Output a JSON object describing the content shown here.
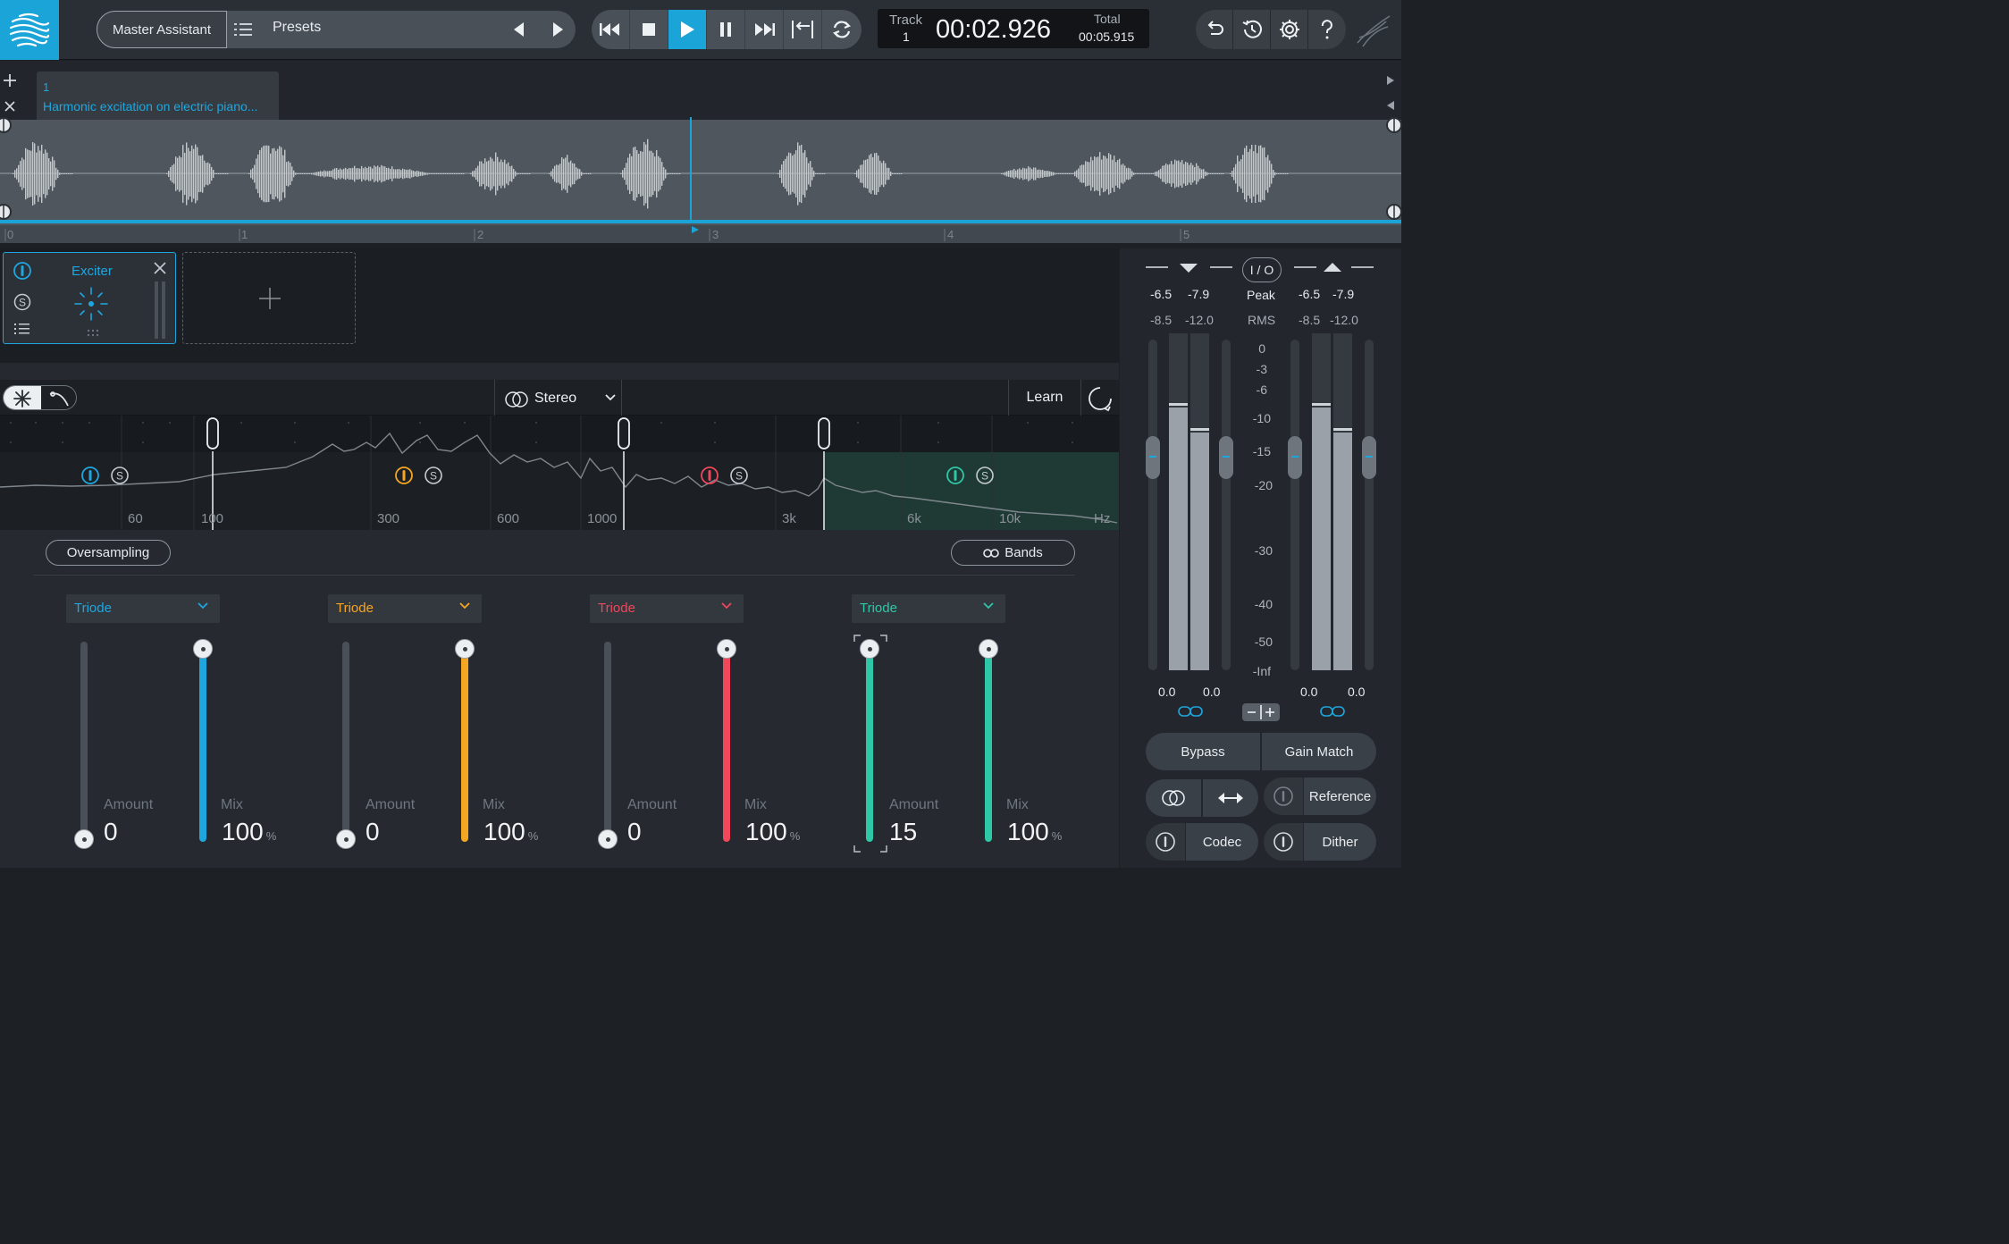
{
  "header": {
    "assistant_label": "Master Assistant",
    "presets_label": "Presets",
    "track_label": "Track",
    "track_number": "1",
    "time": "00:02.926",
    "total_label": "Total",
    "total_time": "00:05.915"
  },
  "track_tab": {
    "number": "1",
    "title": "Harmonic excitation on electric piano..."
  },
  "ruler": {
    "marks": [
      "0",
      "1",
      "2",
      "3",
      "4",
      "5"
    ]
  },
  "playhead_fraction": 0.495,
  "modules": [
    {
      "name": "Exciter"
    }
  ],
  "exciter": {
    "stereo_mode": "Stereo",
    "learn_label": "Learn",
    "oversampling_label": "Oversampling",
    "bands_label": "Bands",
    "freq_labels": [
      "60",
      "100",
      "300",
      "600",
      "1000",
      "3k",
      "6k",
      "10k",
      "Hz"
    ],
    "crossovers_hz": [
      100,
      1000,
      3000
    ],
    "bands": [
      {
        "mode": "Triode",
        "color": "#1ea7df",
        "amount_label": "Amount",
        "amount": "0",
        "mix_label": "Mix",
        "mix": "100",
        "mix_unit": "%"
      },
      {
        "mode": "Triode",
        "color": "#f5a623",
        "amount_label": "Amount",
        "amount": "0",
        "mix_label": "Mix",
        "mix": "100",
        "mix_unit": "%"
      },
      {
        "mode": "Triode",
        "color": "#f0475a",
        "amount_label": "Amount",
        "amount": "0",
        "mix_label": "Mix",
        "mix": "100",
        "mix_unit": "%"
      },
      {
        "mode": "Triode",
        "color": "#2ec7a8",
        "amount_label": "Amount",
        "amount": "15",
        "mix_label": "Mix",
        "mix": "100",
        "mix_unit": "%"
      }
    ]
  },
  "meters": {
    "io_label": "I / O",
    "peak_label": "Peak",
    "rms_label": "RMS",
    "input_peak": [
      "-6.5",
      "-7.9"
    ],
    "input_rms": [
      "-8.5",
      "-12.0"
    ],
    "output_peak": [
      "-6.5",
      "-7.9"
    ],
    "output_rms": [
      "-8.5",
      "-12.0"
    ],
    "scale": [
      "0",
      "-3",
      "-6",
      "-10",
      "-15",
      "-20",
      "-30",
      "-40",
      "-50",
      "-Inf"
    ],
    "input_gain": [
      "0.0",
      "0.0"
    ],
    "output_gain": [
      "0.0",
      "0.0"
    ],
    "bypass_label": "Bypass",
    "gain_match_label": "Gain Match",
    "reference_label": "Reference",
    "codec_label": "Codec",
    "dither_label": "Dither"
  }
}
